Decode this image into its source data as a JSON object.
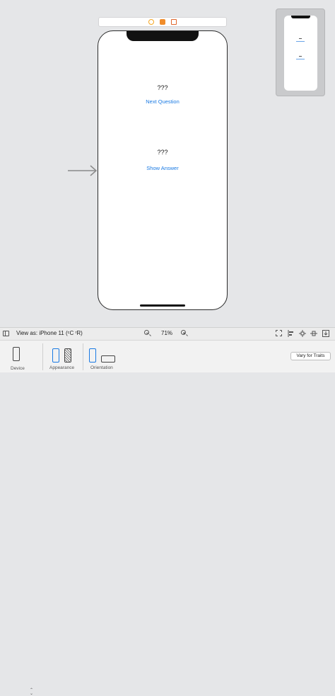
{
  "canvas": {
    "questions": [
      {
        "label": "???",
        "button": "Next Question"
      },
      {
        "label": "???",
        "button": "Show Answer"
      }
    ]
  },
  "toolbar": {
    "view_as": "View as: iPhone 11 (ᶜC ʳR)",
    "zoom": "71%"
  },
  "traits": {
    "device_label": "Device",
    "appearance_label": "Appearance",
    "orientation_label": "Orientation",
    "vary_button": "Vary for Traits"
  },
  "colors": {
    "accent": "#1a7ae3",
    "canvas_bg": "#e5e6e8"
  }
}
